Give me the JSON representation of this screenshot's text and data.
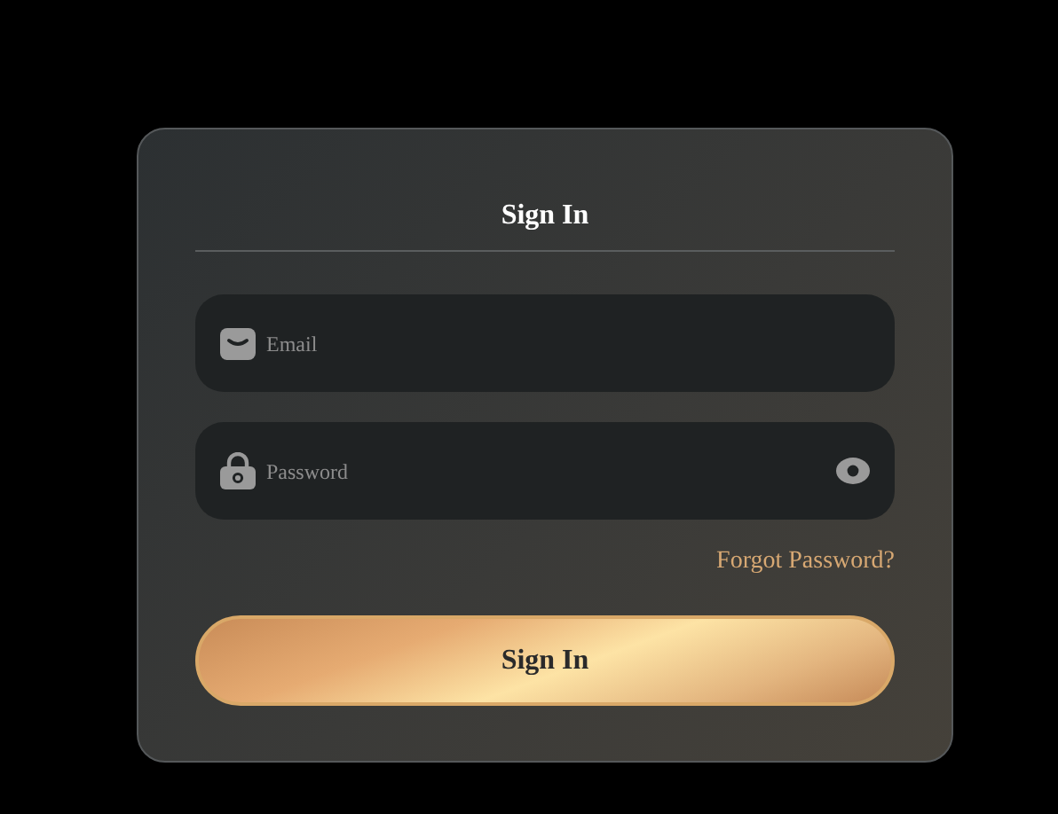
{
  "title": "Sign In",
  "fields": [
    {
      "kind": "email",
      "placeholder": "Email"
    },
    {
      "kind": "password",
      "placeholder": "Password"
    }
  ],
  "forgot_link": "Forgot Password?",
  "submit_button": "Sign In"
}
